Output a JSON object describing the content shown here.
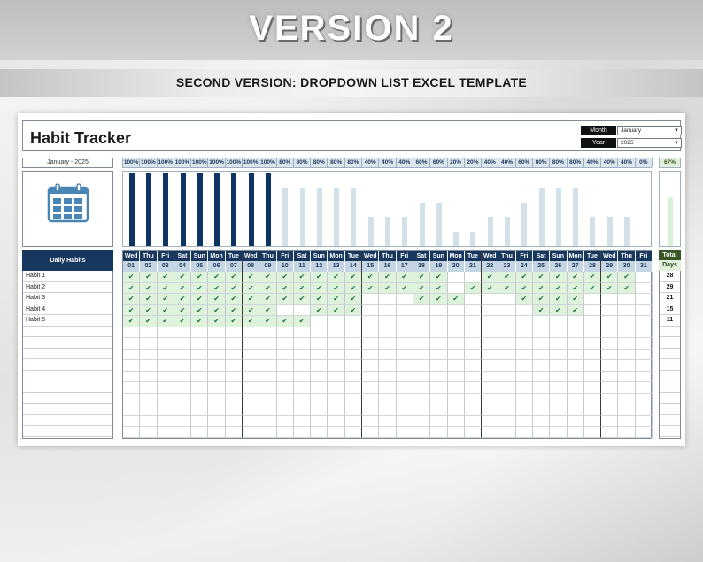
{
  "banner": {
    "title": "VERSION 2",
    "subtitle": "SECOND VERSION: DROPDOWN LIST EXCEL TEMPLATE"
  },
  "sheet": {
    "title": "Habit Tracker",
    "month_label": "Month",
    "month_value": "January",
    "year_label": "Year",
    "year_value": "2025",
    "period": "January - 2025",
    "overall_pct": "67%",
    "daily_habits_header": "Daily Habits",
    "total_header": "Total",
    "days_header": "Days",
    "weekdays": [
      "Wed",
      "Thu",
      "Fri",
      "Sat",
      "Sun",
      "Mon",
      "Tue",
      "Wed",
      "Thu",
      "Fri",
      "Sat",
      "Sun",
      "Mon",
      "Tue",
      "Wed",
      "Thu",
      "Fri",
      "Sat",
      "Sun",
      "Mon",
      "Tue",
      "Wed",
      "Thu",
      "Fri",
      "Sat",
      "Sun",
      "Mon",
      "Tue",
      "Wed",
      "Thu",
      "Fri"
    ],
    "days": [
      "01",
      "02",
      "03",
      "04",
      "05",
      "06",
      "07",
      "08",
      "09",
      "10",
      "11",
      "12",
      "13",
      "14",
      "15",
      "16",
      "17",
      "18",
      "19",
      "20",
      "21",
      "22",
      "23",
      "24",
      "25",
      "26",
      "27",
      "28",
      "29",
      "30",
      "31"
    ],
    "percentages": [
      "100%",
      "100%",
      "100%",
      "100%",
      "100%",
      "100%",
      "100%",
      "100%",
      "100%",
      "80%",
      "80%",
      "80%",
      "80%",
      "80%",
      "40%",
      "40%",
      "40%",
      "60%",
      "60%",
      "20%",
      "20%",
      "40%",
      "40%",
      "60%",
      "80%",
      "80%",
      "80%",
      "40%",
      "40%",
      "40%",
      "0%"
    ],
    "habits": [
      {
        "name": "Habit 1",
        "total": "28",
        "done": [
          1,
          1,
          1,
          1,
          1,
          1,
          1,
          1,
          1,
          1,
          1,
          1,
          1,
          1,
          1,
          1,
          1,
          1,
          1,
          0,
          0,
          1,
          1,
          1,
          1,
          1,
          1,
          1,
          1,
          1,
          0
        ]
      },
      {
        "name": "Habit 2",
        "total": "29",
        "done": [
          1,
          1,
          1,
          1,
          1,
          1,
          1,
          1,
          1,
          1,
          1,
          1,
          1,
          1,
          1,
          1,
          1,
          1,
          1,
          0,
          1,
          1,
          1,
          1,
          1,
          1,
          1,
          1,
          1,
          1,
          0
        ]
      },
      {
        "name": "Habit 3",
        "total": "21",
        "done": [
          1,
          1,
          1,
          1,
          1,
          1,
          1,
          1,
          1,
          1,
          1,
          1,
          1,
          1,
          0,
          0,
          0,
          1,
          1,
          1,
          0,
          0,
          0,
          1,
          1,
          1,
          1,
          0,
          0,
          0,
          0
        ]
      },
      {
        "name": "Habit 4",
        "total": "15",
        "done": [
          1,
          1,
          1,
          1,
          1,
          1,
          1,
          1,
          1,
          0,
          0,
          1,
          1,
          1,
          0,
          0,
          0,
          0,
          0,
          0,
          0,
          0,
          0,
          0,
          1,
          1,
          1,
          0,
          0,
          0,
          0
        ]
      },
      {
        "name": "Habit 5",
        "total": "11",
        "done": [
          1,
          1,
          1,
          1,
          1,
          1,
          1,
          1,
          1,
          1,
          1,
          0,
          0,
          0,
          0,
          0,
          0,
          0,
          0,
          0,
          0,
          0,
          0,
          0,
          0,
          0,
          0,
          0,
          0,
          0,
          0
        ]
      }
    ],
    "check_glyph": "✔",
    "colors": {
      "navy": "#17375e",
      "bar_full": "#0e3463",
      "bar_light": "#d3e0e8",
      "done": "#dff3dc",
      "total_green": "#375623",
      "overall_bar": "#d7f0d8"
    }
  }
}
